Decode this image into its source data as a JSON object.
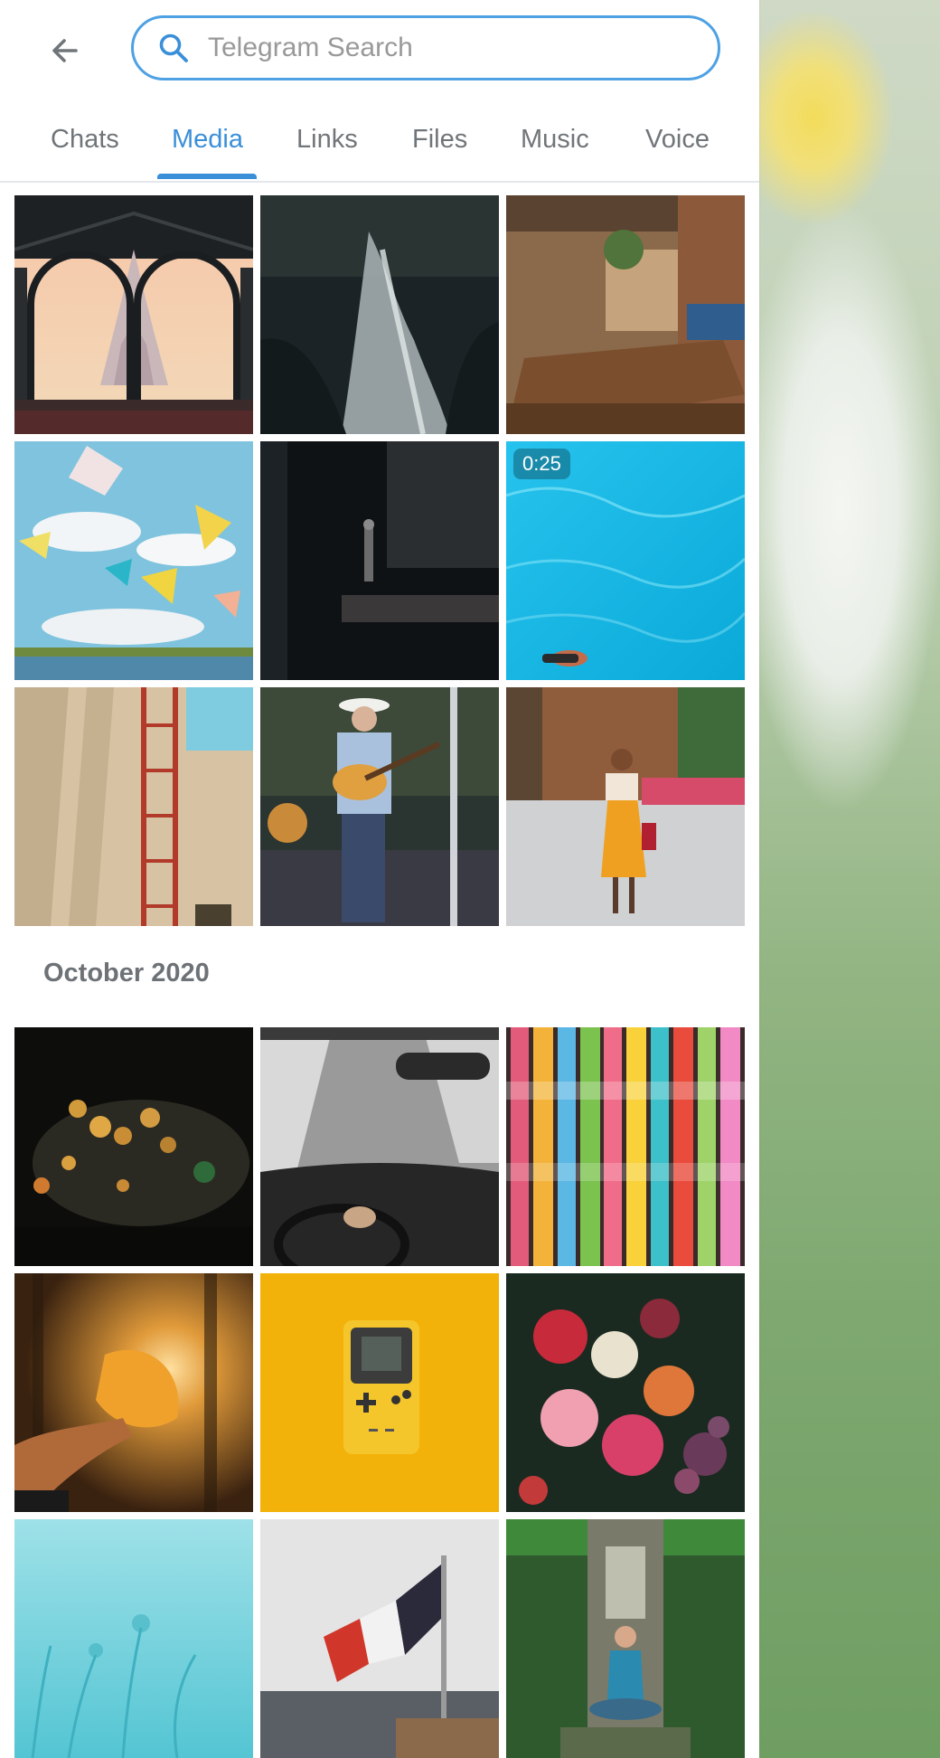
{
  "search": {
    "placeholder": "Telegram Search",
    "value": ""
  },
  "tabs": [
    {
      "label": "Chats",
      "active": false
    },
    {
      "label": "Media",
      "active": true
    },
    {
      "label": "Links",
      "active": false
    },
    {
      "label": "Files",
      "active": false
    },
    {
      "label": "Music",
      "active": false
    },
    {
      "label": "Voice",
      "active": false
    }
  ],
  "media_recent": [
    {
      "subject": "castle"
    },
    {
      "subject": "waterfall"
    },
    {
      "subject": "restaurant"
    },
    {
      "subject": "umbrellas"
    },
    {
      "subject": "building-shadow"
    },
    {
      "subject": "swimming-pool",
      "duration": "0:25"
    },
    {
      "subject": "wall-ladder"
    },
    {
      "subject": "guitarist"
    },
    {
      "subject": "woman-street"
    }
  ],
  "section": {
    "title": "October 2020"
  },
  "media_october": [
    {
      "subject": "mushrooms"
    },
    {
      "subject": "car-snow"
    },
    {
      "subject": "paper-cranes"
    },
    {
      "subject": "autumn-leaf"
    },
    {
      "subject": "game-boy"
    },
    {
      "subject": "flowers-fruit"
    },
    {
      "subject": "grass-sky"
    },
    {
      "subject": "flag-ship"
    },
    {
      "subject": "yoga-garden"
    }
  ],
  "colors": {
    "accent": "#3a8fd9",
    "search_border": "#4ea1e3",
    "tab_inactive": "#707579"
  }
}
